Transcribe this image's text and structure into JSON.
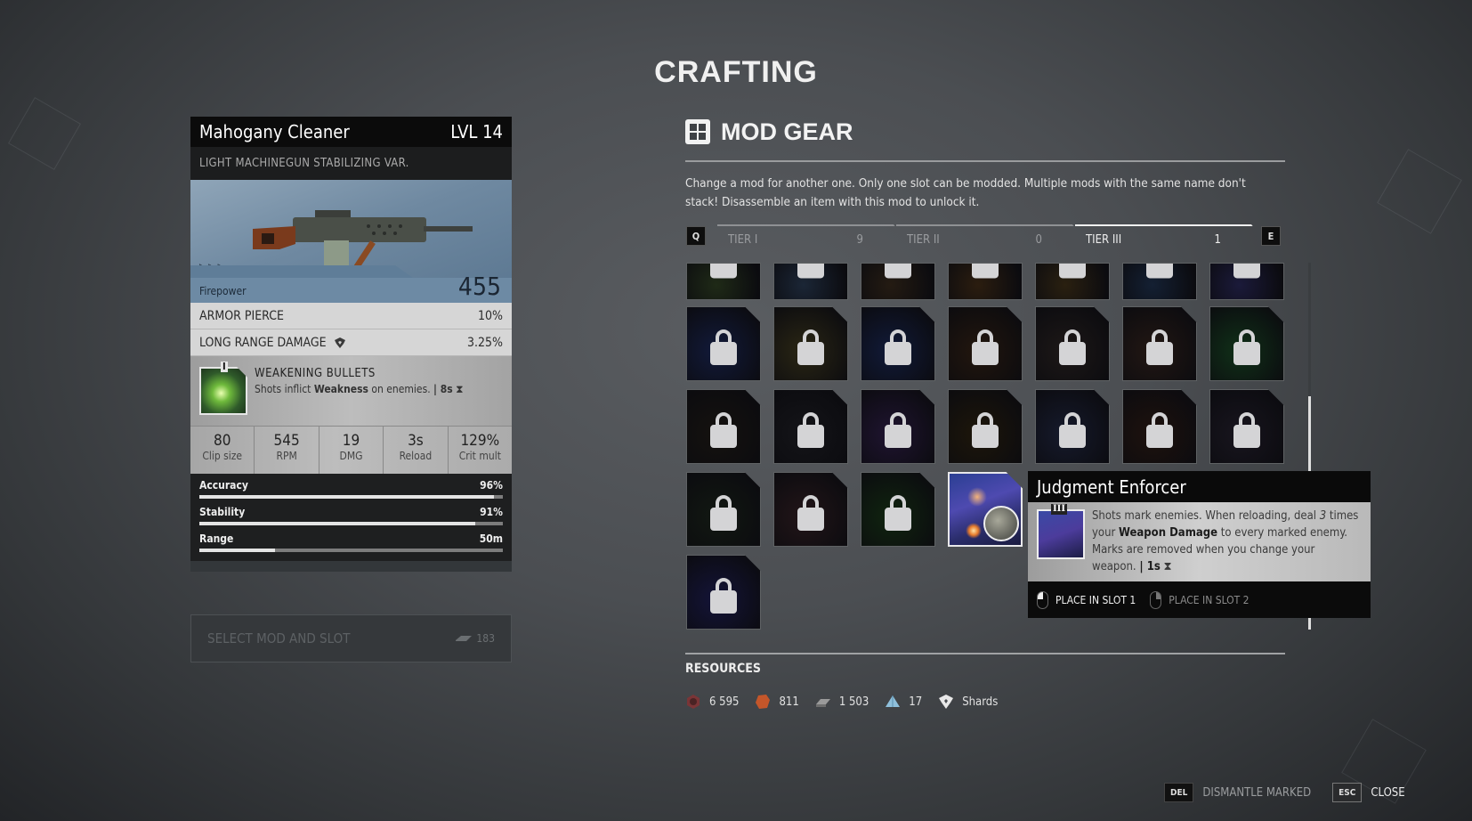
{
  "screen_title": "CRAFTING",
  "weapon": {
    "name": "Mahogany Cleaner",
    "level": "LVL 14",
    "type": "LIGHT MACHINEGUN STABILIZING VAR.",
    "rarity_marks": "▷▷▷",
    "firepower_label": "Firepower",
    "firepower_value": "455",
    "attributes": [
      {
        "label": "ARMOR PIERCE",
        "value": "10%",
        "icon": ""
      },
      {
        "label": "LONG RANGE DAMAGE",
        "value": "3.25%",
        "icon": "shard-icon"
      }
    ],
    "mod": {
      "tier": "I",
      "name": "WEAKENING BULLETS",
      "desc_pre": "Shots inflict ",
      "desc_bold": "Weakness",
      "desc_post": " on enemies. ",
      "duration": "| 8s",
      "duration_icon": "hourglass-icon"
    },
    "stats": [
      {
        "value": "80",
        "label": "Clip size"
      },
      {
        "value": "545",
        "label": "RPM"
      },
      {
        "value": "19",
        "label": "DMG"
      },
      {
        "value": "3s",
        "label": "Reload"
      },
      {
        "value": "129%",
        "label": "Crit mult"
      }
    ],
    "bars": [
      {
        "label": "Accuracy",
        "value": "96%",
        "fill": 0.97
      },
      {
        "label": "Stability",
        "value": "91%",
        "fill": 0.91
      },
      {
        "label": "Range",
        "value": "50m",
        "fill": 0.25
      }
    ]
  },
  "select_button": {
    "label": "SELECT MOD AND SLOT",
    "cost": "183",
    "cost_icon": "scrap-icon"
  },
  "mod_gear": {
    "title": "MOD GEAR",
    "description": "Change a mod for another one. Only one slot can be modded. Multiple mods with the same name don't stack! Disassemble an item with this mod to unlock it.",
    "prev_key": "Q",
    "next_key": "E",
    "tabs": [
      {
        "label": "TIER I",
        "count": "9",
        "active": false
      },
      {
        "label": "TIER II",
        "count": "0",
        "active": false
      },
      {
        "label": "TIER III",
        "count": "1",
        "active": true
      }
    ],
    "tiles": [
      {
        "row": 0,
        "col": 0,
        "locked": true,
        "partial": true,
        "bg": "#1f2a17"
      },
      {
        "row": 0,
        "col": 1,
        "locked": true,
        "partial": true,
        "bg": "#1b2636"
      },
      {
        "row": 0,
        "col": 2,
        "locked": true,
        "partial": true,
        "bg": "#241b12"
      },
      {
        "row": 0,
        "col": 3,
        "locked": true,
        "partial": true,
        "bg": "#2b1d0f"
      },
      {
        "row": 0,
        "col": 4,
        "locked": true,
        "partial": true,
        "bg": "#2a2010"
      },
      {
        "row": 0,
        "col": 5,
        "locked": true,
        "partial": true,
        "bg": "#142033"
      },
      {
        "row": 0,
        "col": 6,
        "locked": true,
        "partial": true,
        "bg": "#1b1a3a"
      },
      {
        "row": 1,
        "col": 0,
        "locked": true,
        "bg": "#121a3a"
      },
      {
        "row": 1,
        "col": 1,
        "locked": true,
        "bg": "#2a2614"
      },
      {
        "row": 1,
        "col": 2,
        "locked": true,
        "bg": "#111a38"
      },
      {
        "row": 1,
        "col": 3,
        "locked": true,
        "bg": "#22160d"
      },
      {
        "row": 1,
        "col": 4,
        "locked": true,
        "bg": "#1d1817"
      },
      {
        "row": 1,
        "col": 5,
        "locked": true,
        "bg": "#221713"
      },
      {
        "row": 1,
        "col": 6,
        "locked": true,
        "bg": "#103018"
      },
      {
        "row": 2,
        "col": 0,
        "locked": true,
        "bg": "#15120f"
      },
      {
        "row": 2,
        "col": 1,
        "locked": true,
        "bg": "#141418"
      },
      {
        "row": 2,
        "col": 2,
        "locked": true,
        "bg": "#1f1430"
      },
      {
        "row": 2,
        "col": 3,
        "locked": true,
        "bg": "#1d160a"
      },
      {
        "row": 2,
        "col": 4,
        "locked": true,
        "bg": "#161a2c"
      },
      {
        "row": 2,
        "col": 5,
        "locked": true,
        "bg": "#1e120e"
      },
      {
        "row": 2,
        "col": 6,
        "locked": true,
        "bg": "#18151e"
      },
      {
        "row": 3,
        "col": 0,
        "locked": true,
        "bg": "#121812"
      },
      {
        "row": 3,
        "col": 1,
        "locked": true,
        "bg": "#221518"
      },
      {
        "row": 3,
        "col": 2,
        "locked": true,
        "bg": "#10240f"
      },
      {
        "row": 3,
        "col": 3,
        "locked": false,
        "selected": true,
        "name": "Judgment Enforcer"
      },
      {
        "row": 4,
        "col": 0,
        "locked": true,
        "bg": "#141438"
      }
    ]
  },
  "tooltip": {
    "title": "Judgment Enforcer",
    "tier": "III",
    "desc_1": "Shots mark enemies. When reloading, deal ",
    "desc_italic": "3",
    "desc_2": " times your ",
    "desc_bold": "Weapon Damage",
    "desc_3": " to every marked enemy. Marks are removed when you change your weapon. ",
    "duration": "| 1s",
    "actions": [
      {
        "label": "PLACE IN SLOT 1",
        "mouse": "left-click-icon"
      },
      {
        "label": "PLACE IN SLOT 2",
        "mouse": "right-click-icon"
      }
    ]
  },
  "resources": {
    "title": "RESOURCES",
    "items": [
      {
        "icon": "iron-nut-icon",
        "value": "6 595",
        "color": "#a0383a"
      },
      {
        "icon": "leather-icon",
        "value": "811",
        "color": "#c4562a"
      },
      {
        "icon": "scrap-icon",
        "value": "1 503",
        "color": "#9a9a9a"
      },
      {
        "icon": "crystal-icon",
        "value": "17",
        "color": "#8fc0dc"
      },
      {
        "icon": "shard-icon",
        "value": "Shards",
        "color": "#e8e8e8"
      }
    ]
  },
  "footer": {
    "dismantle_key": "DEL",
    "dismantle_label": "DISMANTLE MARKED",
    "close_key": "ESC",
    "close_label": "CLOSE"
  }
}
